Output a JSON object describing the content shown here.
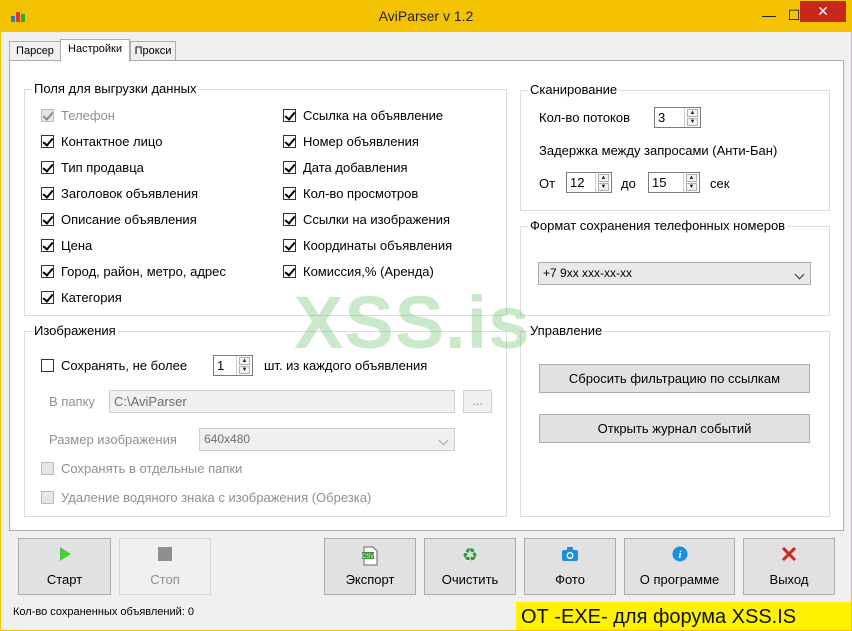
{
  "window": {
    "title": "AviParser v 1.2",
    "minimize": "—",
    "maximize": "☐",
    "close": "✕"
  },
  "tabs": [
    "Парсер",
    "Настройки",
    "Прокси"
  ],
  "fields": {
    "title": "Поля для выгрузки данных",
    "left": [
      {
        "label": "Телефон",
        "checked": true,
        "disabled": true
      },
      {
        "label": "Контактное лицо",
        "checked": true
      },
      {
        "label": "Тип продавца",
        "checked": true
      },
      {
        "label": "Заголовок объявления",
        "checked": true
      },
      {
        "label": "Описание объявления",
        "checked": true
      },
      {
        "label": "Цена",
        "checked": true
      },
      {
        "label": " Город, район, метро, адрес",
        "checked": true
      },
      {
        "label": "Категория",
        "checked": true
      }
    ],
    "right": [
      {
        "label": "Ссылка на объявление",
        "checked": true
      },
      {
        "label": "Номер объявления",
        "checked": true
      },
      {
        "label": "Дата добавления",
        "checked": true
      },
      {
        "label": "Кол-во просмотров",
        "checked": true
      },
      {
        "label": "Ссылки на изображения",
        "checked": true
      },
      {
        "label": "Координаты объявления",
        "checked": true
      },
      {
        "label": "Комиссия,% (Аренда)",
        "checked": true
      }
    ]
  },
  "scan": {
    "title": "Сканирование",
    "threads_label": "Кол-во потоков",
    "threads": "3",
    "delay_label": "Задержка между запросами (Анти-Бан)",
    "from_label": "От",
    "from_value": "12",
    "to_label": "до",
    "to_value": "15",
    "unit": "сек"
  },
  "phone_format": {
    "title": "Формат сохранения телефонных номеров",
    "selected": "+7 9xx xxx-xx-xx"
  },
  "images": {
    "title": "Изображения",
    "save_label": "Сохранять, не более",
    "save_checked": false,
    "save_count": "1",
    "save_suffix": "шт. из каждого объявления",
    "folder_label": "В папку",
    "folder_value": "C:\\AviParser",
    "browse": "...",
    "size_label": "Размер изображения",
    "size_value": "640x480",
    "separate_folders": "Сохранять в отдельные папки",
    "watermark": "Удаление водяного знака с изображения (Обрезка)"
  },
  "control": {
    "title": "Управление",
    "reset_button": "Сбросить фильтрацию по ссылкам",
    "log_button": "Открыть журнал событий"
  },
  "toolbar": {
    "start": "Старт",
    "stop": "Стоп",
    "export": "Экспорт",
    "clear": "Очистить",
    "photo": "Фото",
    "about": "О программе",
    "exit": "Выход"
  },
  "status": "Кол-во сохраненных объявлений: 0",
  "watermark_text": "XSS.is",
  "credit": "ОТ -EXE- для форума XSS.IS",
  "colors": {
    "titlebar": "#f4c200",
    "close": "#c7281a",
    "credit_bg": "#fff200",
    "play": "#4ccb3a",
    "recycle": "#2f9a3a",
    "camera": "#1d8fe0",
    "info": "#1d8fe0",
    "exit_x": "#d92020"
  }
}
